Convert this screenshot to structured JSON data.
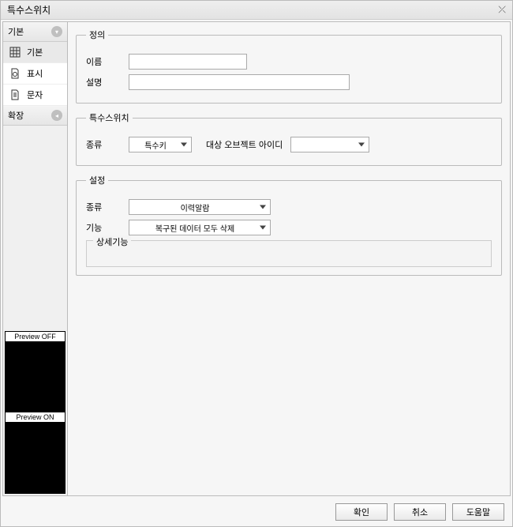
{
  "title": "특수스위치",
  "sidebar": {
    "section1": {
      "label": "기본"
    },
    "section2": {
      "label": "확장"
    },
    "items": [
      {
        "label": "기본"
      },
      {
        "label": "표시"
      },
      {
        "label": "문자"
      }
    ]
  },
  "preview": {
    "off": "Preview OFF",
    "on": "Preview ON"
  },
  "panels": {
    "definition": {
      "legend": "정의",
      "nameLabel": "이름",
      "descLabel": "설명",
      "nameValue": "",
      "descValue": ""
    },
    "special": {
      "legend": "특수스위치",
      "kindLabel": "종류",
      "kindValue": "특수키",
      "targetLabel": "대상 오브젝트 아이디",
      "targetValue": ""
    },
    "settings": {
      "legend": "설정",
      "kindLabel": "종류",
      "kindValue": "이력알람",
      "funcLabel": "기능",
      "funcValue": "복구된 데이터 모두 삭제",
      "detail": {
        "legend": "상세기능"
      }
    }
  },
  "footer": {
    "ok": "확인",
    "cancel": "취소",
    "help": "도움말"
  }
}
